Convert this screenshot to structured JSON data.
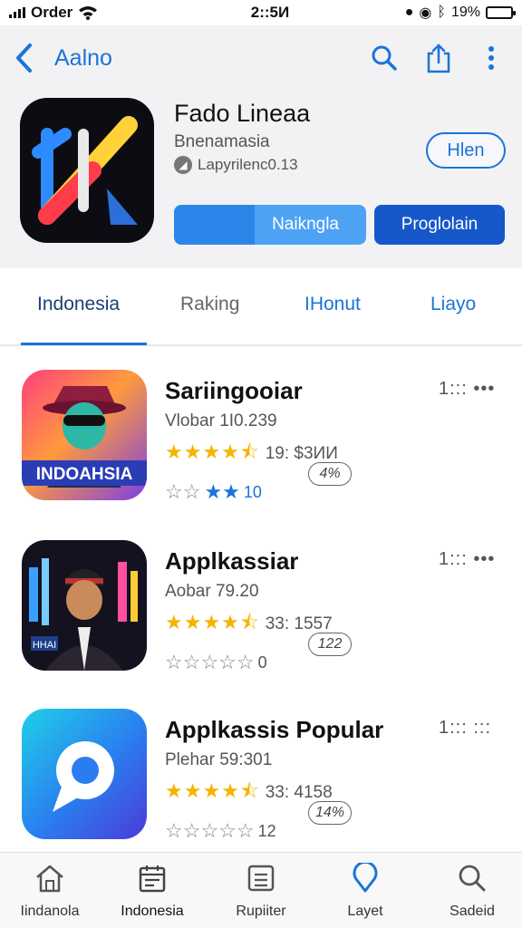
{
  "status_bar": {
    "carrier": "Order",
    "time": "2::5И",
    "battery": "19%",
    "battery_level": 0.85
  },
  "nav": {
    "back_icon": "chevron-left-icon",
    "title": "Aalno",
    "actions": [
      "search-icon",
      "share-icon",
      "more-vertical-icon"
    ]
  },
  "app": {
    "name": "Fado Lineaa",
    "subtitle": "Bnenamasia",
    "meta": "Lapyrilenc0.13",
    "get_label": "Hlen",
    "secondary_button": "Naikngla",
    "primary_button": "Proglolain"
  },
  "tabs": [
    {
      "label": "Indonesia",
      "active": true
    },
    {
      "label": "Raking",
      "active": false
    },
    {
      "label": "IHonut",
      "active": false
    },
    {
      "label": "Liayo",
      "active": false
    }
  ],
  "rows": [
    {
      "title": "Sariingooiar",
      "subtitle": "Vlobar 1I0.239",
      "rating_stars": 4.5,
      "rating_text": "19: $3ИИ",
      "pill": "4%",
      "outline_stars": "☆☆",
      "blue_stars": "★★",
      "count": "10",
      "more": "1::: •••",
      "icon_text": "INDOAHSIA"
    },
    {
      "title": "Applkassiar",
      "subtitle": "Aobar 79.20",
      "rating_stars": 4.5,
      "rating_text": "33: 1557",
      "pill": "122",
      "outline_stars": "☆☆☆☆☆",
      "blue_stars": "",
      "count": "0",
      "more": "1::: •••",
      "icon_text": "HHAI"
    },
    {
      "title": "Applkassis Popular",
      "subtitle": "Plehar 59:301",
      "rating_stars": 4.5,
      "rating_text": "33: 4158",
      "pill": "14%",
      "outline_stars": "☆☆☆☆☆",
      "blue_stars": "",
      "count": "12",
      "more": "1::: :::",
      "icon_text": ""
    }
  ],
  "tab_bar": [
    {
      "label": "Iindanola",
      "icon": "home-icon"
    },
    {
      "label": "Indonesia",
      "icon": "calendar-icon"
    },
    {
      "label": "Rupiiter",
      "icon": "list-icon"
    },
    {
      "label": "Layet",
      "icon": "location-pin-icon"
    },
    {
      "label": "Sadeid",
      "icon": "search-icon"
    }
  ],
  "colors": {
    "accent": "#1a74d9",
    "primary_button": "#1658c9",
    "star": "#f5b400"
  }
}
